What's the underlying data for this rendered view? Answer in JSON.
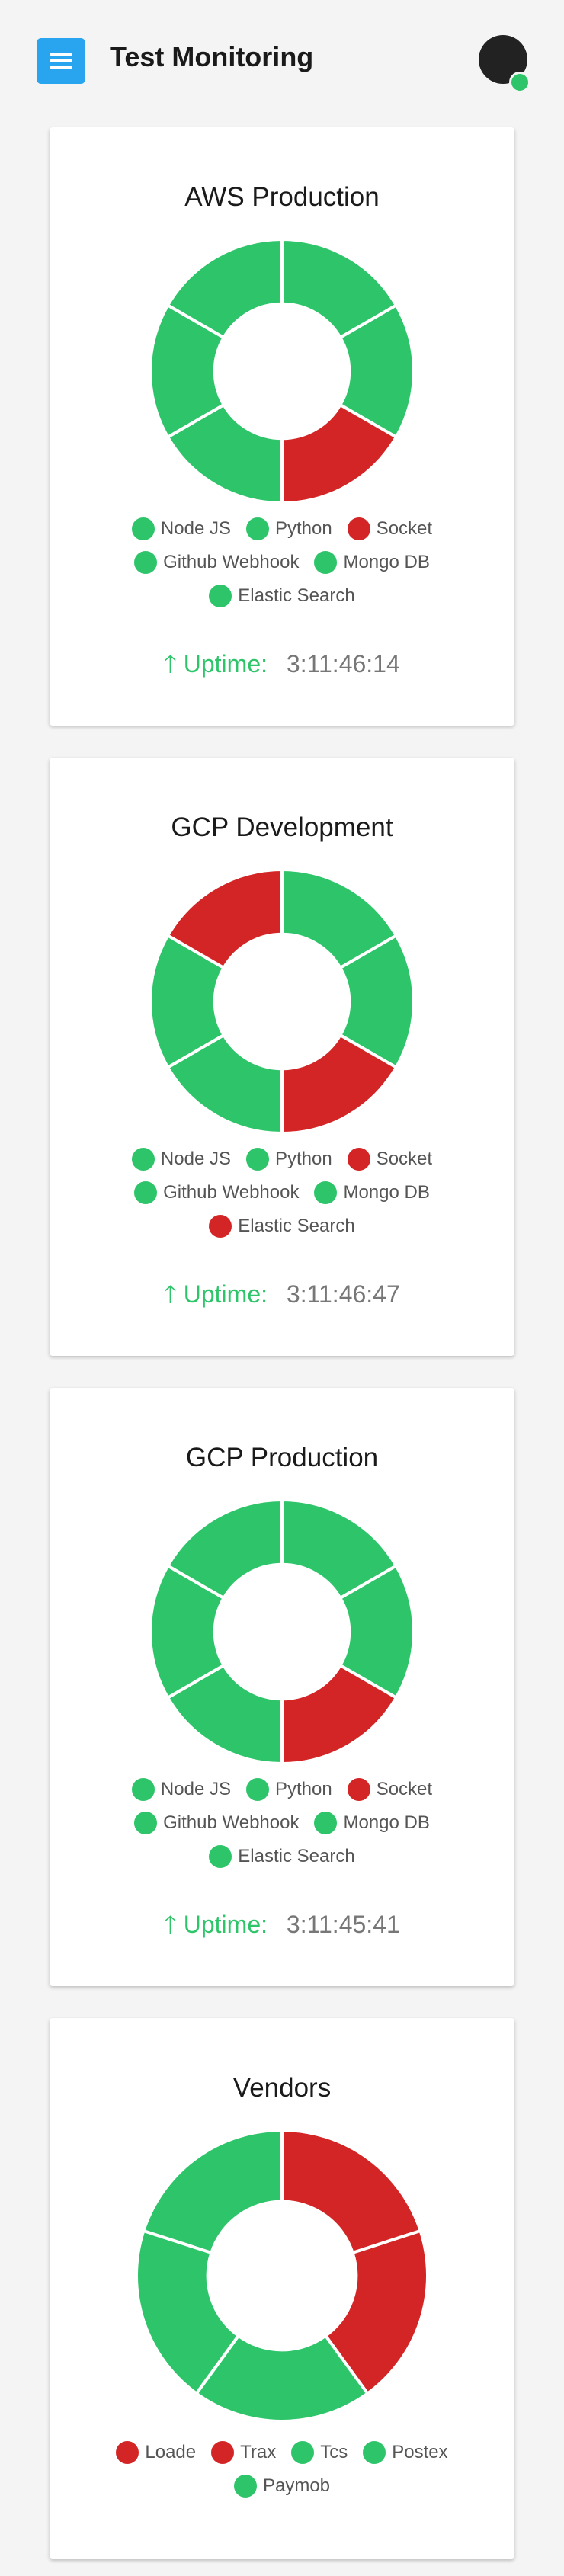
{
  "app": {
    "title": "Test Monitoring",
    "menu_icon": "hamburger-menu-icon",
    "avatar_status_color": "#2ec56a"
  },
  "colors": {
    "up": "#2ec56a",
    "down": "#d32525",
    "accent": "#29a5f0"
  },
  "uptime_label": "Uptime:",
  "cards": [
    {
      "title": "AWS Production",
      "services": [
        {
          "name": "Node JS",
          "status": "up"
        },
        {
          "name": "Python",
          "status": "up"
        },
        {
          "name": "Socket",
          "status": "down"
        },
        {
          "name": "Github Webhook",
          "status": "up"
        },
        {
          "name": "Mongo DB",
          "status": "up"
        },
        {
          "name": "Elastic Search",
          "status": "up"
        }
      ],
      "uptime": "3:11:46:14"
    },
    {
      "title": "GCP Development",
      "services": [
        {
          "name": "Node JS",
          "status": "up"
        },
        {
          "name": "Python",
          "status": "up"
        },
        {
          "name": "Socket",
          "status": "down"
        },
        {
          "name": "Github Webhook",
          "status": "up"
        },
        {
          "name": "Mongo DB",
          "status": "up"
        },
        {
          "name": "Elastic Search",
          "status": "down"
        }
      ],
      "uptime": "3:11:46:47"
    },
    {
      "title": "GCP Production",
      "services": [
        {
          "name": "Node JS",
          "status": "up"
        },
        {
          "name": "Python",
          "status": "up"
        },
        {
          "name": "Socket",
          "status": "down"
        },
        {
          "name": "Github Webhook",
          "status": "up"
        },
        {
          "name": "Mongo DB",
          "status": "up"
        },
        {
          "name": "Elastic Search",
          "status": "up"
        }
      ],
      "uptime": "3:11:45:41"
    },
    {
      "title": "Vendors",
      "services": [
        {
          "name": "Loade",
          "status": "down"
        },
        {
          "name": "Trax",
          "status": "down"
        },
        {
          "name": "Tcs",
          "status": "up"
        },
        {
          "name": "Postex",
          "status": "up"
        },
        {
          "name": "Paymob",
          "status": "up"
        }
      ]
    }
  ]
}
